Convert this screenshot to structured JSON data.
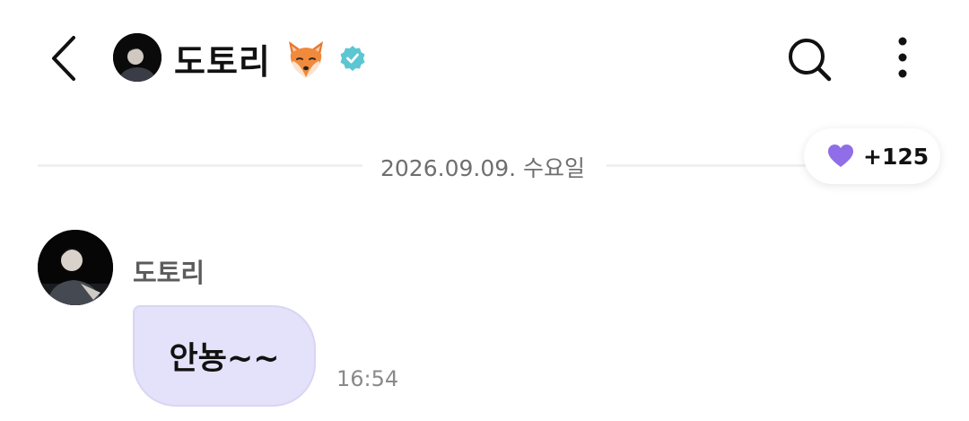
{
  "header": {
    "title": "도토리",
    "emoji_icon": "fox-face-icon",
    "badge_icon": "verified-badge-icon",
    "colors": {
      "badge": "#5cc6d2"
    }
  },
  "date_divider": {
    "text": "2026.09.09. 수요일"
  },
  "reaction": {
    "icon": "purple-heart-icon",
    "count": "+125",
    "color": "#8f6ee8"
  },
  "messages": [
    {
      "sender": "도토리",
      "text": "안뇽~~",
      "time": "16:54",
      "bubble_color": "#e4e1fa"
    }
  ]
}
